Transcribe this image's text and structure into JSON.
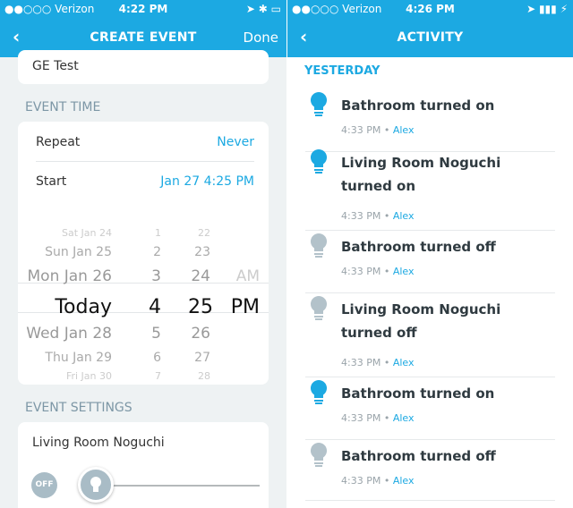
{
  "left": {
    "status": {
      "carrier": "●●○○○ Verizon",
      "time": "4:22 PM",
      "right": "➤ ✱ ▭"
    },
    "nav": {
      "back": "‹",
      "title": "CREATE EVENT",
      "done": "Done"
    },
    "event_name": "GE Test",
    "event_time_header": "EVENT TIME",
    "repeat": {
      "label": "Repeat",
      "value": "Never"
    },
    "start": {
      "label": "Start",
      "value": "Jan 27 4:25 PM"
    },
    "picker": {
      "days": [
        "Sat Jan 24",
        "Sun Jan 25",
        "Mon Jan 26",
        "Today",
        "Wed Jan 28",
        "Thu Jan 29",
        "Fri Jan 30"
      ],
      "hours": [
        "1",
        "2",
        "3",
        "4",
        "5",
        "6",
        "7"
      ],
      "minutes": [
        "22",
        "23",
        "24",
        "25",
        "26",
        "27",
        "28"
      ],
      "ampm": [
        "AM",
        "PM"
      ]
    },
    "event_settings_header": "EVENT SETTINGS",
    "device": {
      "name": "Living Room Noguchi",
      "off_label": "OFF",
      "brightness": 0
    }
  },
  "right": {
    "status": {
      "carrier": "●●○○○ Verizon",
      "time": "4:26 PM",
      "right": "➤ ▮▮▮ ⚡"
    },
    "nav": {
      "back": "‹",
      "title": "ACTIVITY"
    },
    "section": "YESTERDAY",
    "items": [
      {
        "title": "Bathroom turned on",
        "time": "4:33 PM",
        "user": "Alex",
        "on": true
      },
      {
        "title": "Living Room Noguchi turned on",
        "time": "4:33 PM",
        "user": "Alex",
        "on": true
      },
      {
        "title": "Bathroom turned off",
        "time": "4:33 PM",
        "user": "Alex",
        "on": false
      },
      {
        "title": "Living Room Noguchi turned off",
        "time": "4:33 PM",
        "user": "Alex",
        "on": false
      },
      {
        "title": "Bathroom turned on",
        "time": "4:33 PM",
        "user": "Alex",
        "on": true
      },
      {
        "title": "Bathroom turned off",
        "time": "4:33 PM",
        "user": "Alex",
        "on": false
      }
    ],
    "colors": {
      "on": "#1ca9e2",
      "off": "#b3c2ca"
    }
  }
}
